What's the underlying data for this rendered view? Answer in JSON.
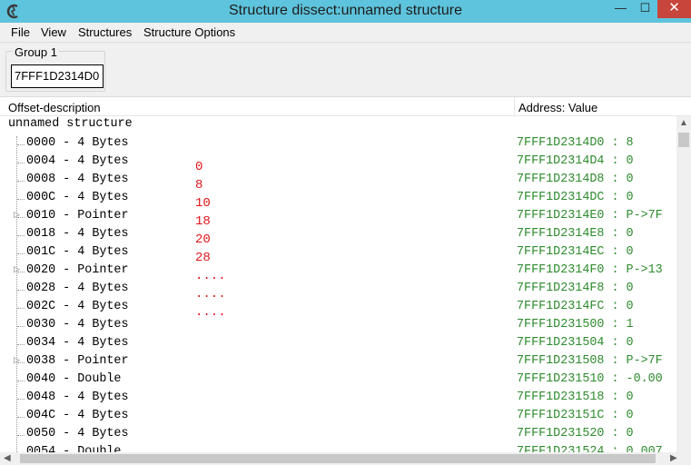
{
  "window": {
    "title": "Structure dissect:unnamed structure",
    "minimize_glyph": "—",
    "maximize_glyph": "☐",
    "close_glyph": "✕"
  },
  "menu": [
    "File",
    "View",
    "Structures",
    "Structure Options"
  ],
  "group": {
    "label": "Group 1",
    "address": "7FFF1D2314D0"
  },
  "columns": {
    "left": "Offset-description",
    "right": "Address: Value"
  },
  "tree": {
    "root": "unnamed structure",
    "rows": [
      {
        "desc": "0000 - 4 Bytes",
        "value": "7FFF1D2314D0 : 8",
        "expandable": false
      },
      {
        "desc": "0004 - 4 Bytes",
        "value": "7FFF1D2314D4 : 0",
        "expandable": false
      },
      {
        "desc": "0008 - 4 Bytes",
        "value": "7FFF1D2314D8 : 0",
        "expandable": false
      },
      {
        "desc": "000C - 4 Bytes",
        "value": "7FFF1D2314DC : 0",
        "expandable": false
      },
      {
        "desc": "0010 - Pointer",
        "value": "7FFF1D2314E0 : P->7F",
        "expandable": true
      },
      {
        "desc": "0018 - 4 Bytes",
        "value": "7FFF1D2314E8 : 0",
        "expandable": false
      },
      {
        "desc": "001C - 4 Bytes",
        "value": "7FFF1D2314EC : 0",
        "expandable": false
      },
      {
        "desc": "0020 - Pointer",
        "value": "7FFF1D2314F0 : P->13",
        "expandable": true
      },
      {
        "desc": "0028 - 4 Bytes",
        "value": "7FFF1D2314F8 : 0",
        "expandable": false
      },
      {
        "desc": "002C - 4 Bytes",
        "value": "7FFF1D2314FC : 0",
        "expandable": false
      },
      {
        "desc": "0030 - 4 Bytes",
        "value": "7FFF1D231500 : 1",
        "expandable": false
      },
      {
        "desc": "0034 - 4 Bytes",
        "value": "7FFF1D231504 : 0",
        "expandable": false
      },
      {
        "desc": "0038 - Pointer",
        "value": "7FFF1D231508 : P->7F",
        "expandable": true
      },
      {
        "desc": "0040 - Double",
        "value": "7FFF1D231510 : -0.00",
        "expandable": false
      },
      {
        "desc": "0048 - 4 Bytes",
        "value": "7FFF1D231518 : 0",
        "expandable": false
      },
      {
        "desc": "004C - 4 Bytes",
        "value": "7FFF1D23151C : 0",
        "expandable": false
      },
      {
        "desc": "0050 - 4 Bytes",
        "value": "7FFF1D231520 : 0",
        "expandable": false
      },
      {
        "desc": "0054 - Double",
        "value": "7FFF1D231524 : 0.007",
        "expandable": false
      }
    ]
  },
  "annotations": [
    "0",
    "8",
    "10",
    "18",
    "20",
    "28",
    "....",
    "....",
    "...."
  ],
  "colors": {
    "titlebar": "#5ec3dc",
    "close_button": "#c7453b",
    "value_text": "#2e8b2e",
    "annotation": "#e0151b"
  },
  "icons": {
    "app": "cheat-engine-icon",
    "expander": "triangle-right-icon",
    "scroll_up": "arrow-up-icon",
    "scroll_left": "arrow-left-icon",
    "scroll_right": "arrow-right-icon",
    "expander_glyph": "▷",
    "scroll_up_glyph": "▲",
    "scroll_left_glyph": "◀",
    "scroll_right_glyph": "▶"
  }
}
